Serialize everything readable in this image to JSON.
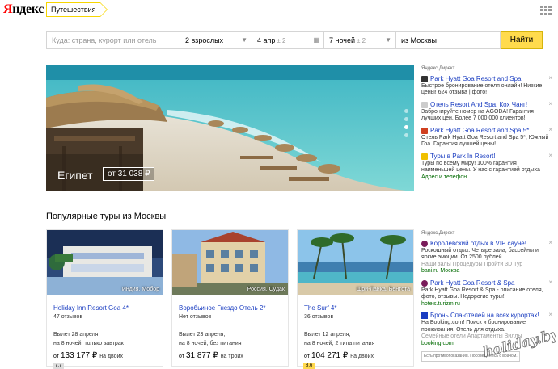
{
  "header": {
    "logo_first": "Я",
    "logo_rest": "ндекс",
    "service": "Путешествия"
  },
  "search": {
    "where_placeholder": "Куда: страна, курорт или отель",
    "people": "2 взрослых",
    "date": "4 апр",
    "date_hint": "± 2",
    "nights": "7 ночей",
    "nights_hint": "± 2",
    "from": "из Москвы",
    "button": "Найти"
  },
  "hero": {
    "country": "Египет",
    "price": "от 31 038 ₽"
  },
  "direct_top": {
    "label": "Яндекс.Директ",
    "ads": [
      {
        "title": "Park Hyatt Goa Resort and Spa",
        "body": "Быстрое бронирование отеля онлайн! Низкие цены! 624 отзыва | фото!",
        "fav_color": "#333333"
      },
      {
        "title": "Отель Resort And Spa, Кох Чанг!",
        "body": "Забронируйте номер на AGODA! Гарантия лучших цен. Более 7 000 000 клиентов!",
        "fav_color": "#cccccc"
      },
      {
        "title": "Park Hyatt Goa Resort and Spa 5*",
        "body": "Отель Park Hyatt Goa Resort and Spa 5*, Южный Гоа. Гарантия лучшей цены!",
        "fav_color": "#d04020"
      },
      {
        "title": "Туры в Park In Resort!",
        "body": "Туры по всему миру! 100% гарантия наименьшей цены. У нас с гарантией отдыха",
        "link": "Адрес и телефон",
        "fav_color": "#f0c000"
      }
    ]
  },
  "section_title": "Популярные туры из Москвы",
  "cards": [
    {
      "location": "Индия, Мобор",
      "rating": "7.7",
      "rating_color": "#dddddd",
      "name": "Holiday Inn Resort Goa 4*",
      "reviews": "47 отзывов",
      "depart_line1": "Вылет 28 апреля,",
      "depart_line2": "на 8 ночей, только завтрак",
      "price_pre": "от",
      "price": "133 177 ₽",
      "price_per": "на двоих"
    },
    {
      "location": "Россия, Судак",
      "rating": "",
      "rating_color": "",
      "name": "Воробьиное Гнездо Отель 2*",
      "reviews": "Нет отзывов",
      "depart_line1": "Вылет 23 апреля,",
      "depart_line2": "на 8 ночей, без питания",
      "price_pre": "от",
      "price": "31 877 ₽",
      "price_per": "на троих"
    },
    {
      "location": "Шри-Ланка, Бентота",
      "rating": "8.6",
      "rating_color": "#ffd84d",
      "name": "The Surf 4*",
      "reviews": "36 отзывов",
      "depart_line1": "Вылет 12 апреля,",
      "depart_line2": "на 8 ночей, 2 типа питания",
      "price_pre": "от",
      "price": "104 271 ₽",
      "price_per": "на двоих"
    }
  ],
  "direct_bottom": {
    "label": "Яндекс.Директ",
    "ads": [
      {
        "title": "Королевский отдых в VIP сауне!",
        "body": "Роскошный отдых. Четыре зала, бассейны и яркие эмоции. От 2500 рублей.",
        "sub": "Наши залы   Процедуры   Пройти 3D Тур",
        "link": "bani.ru   Москва",
        "fav_color": "#7a1d5a"
      },
      {
        "title": "Park Hyatt Goa Resort & Spa",
        "body": "Park Hyatt Goa Resort & Spa - описание отеля, фото, отзывы. Недорогие туры!",
        "link": "hotels.turizm.ru",
        "fav_color": "#7a1d5a"
      },
      {
        "title": "Бронь Спа-отелей на всех курортах!",
        "body": "На Booking.com! Поиск и бронирование проживания. Отель для отдыха.",
        "sub": "Семейные отели   Апартаменты   Виллы",
        "link": "booking.com",
        "fav_color": "#1a3dc1"
      }
    ],
    "footnote": "Есть противопоказания. Посоветуйтесь с врачом."
  },
  "watermark": "holiday.by",
  "colors": {
    "accent_yellow": "#ffdb4d",
    "link_blue": "#1a3dc1",
    "ad_green": "#006a00",
    "logo_red": "#ff0000"
  }
}
